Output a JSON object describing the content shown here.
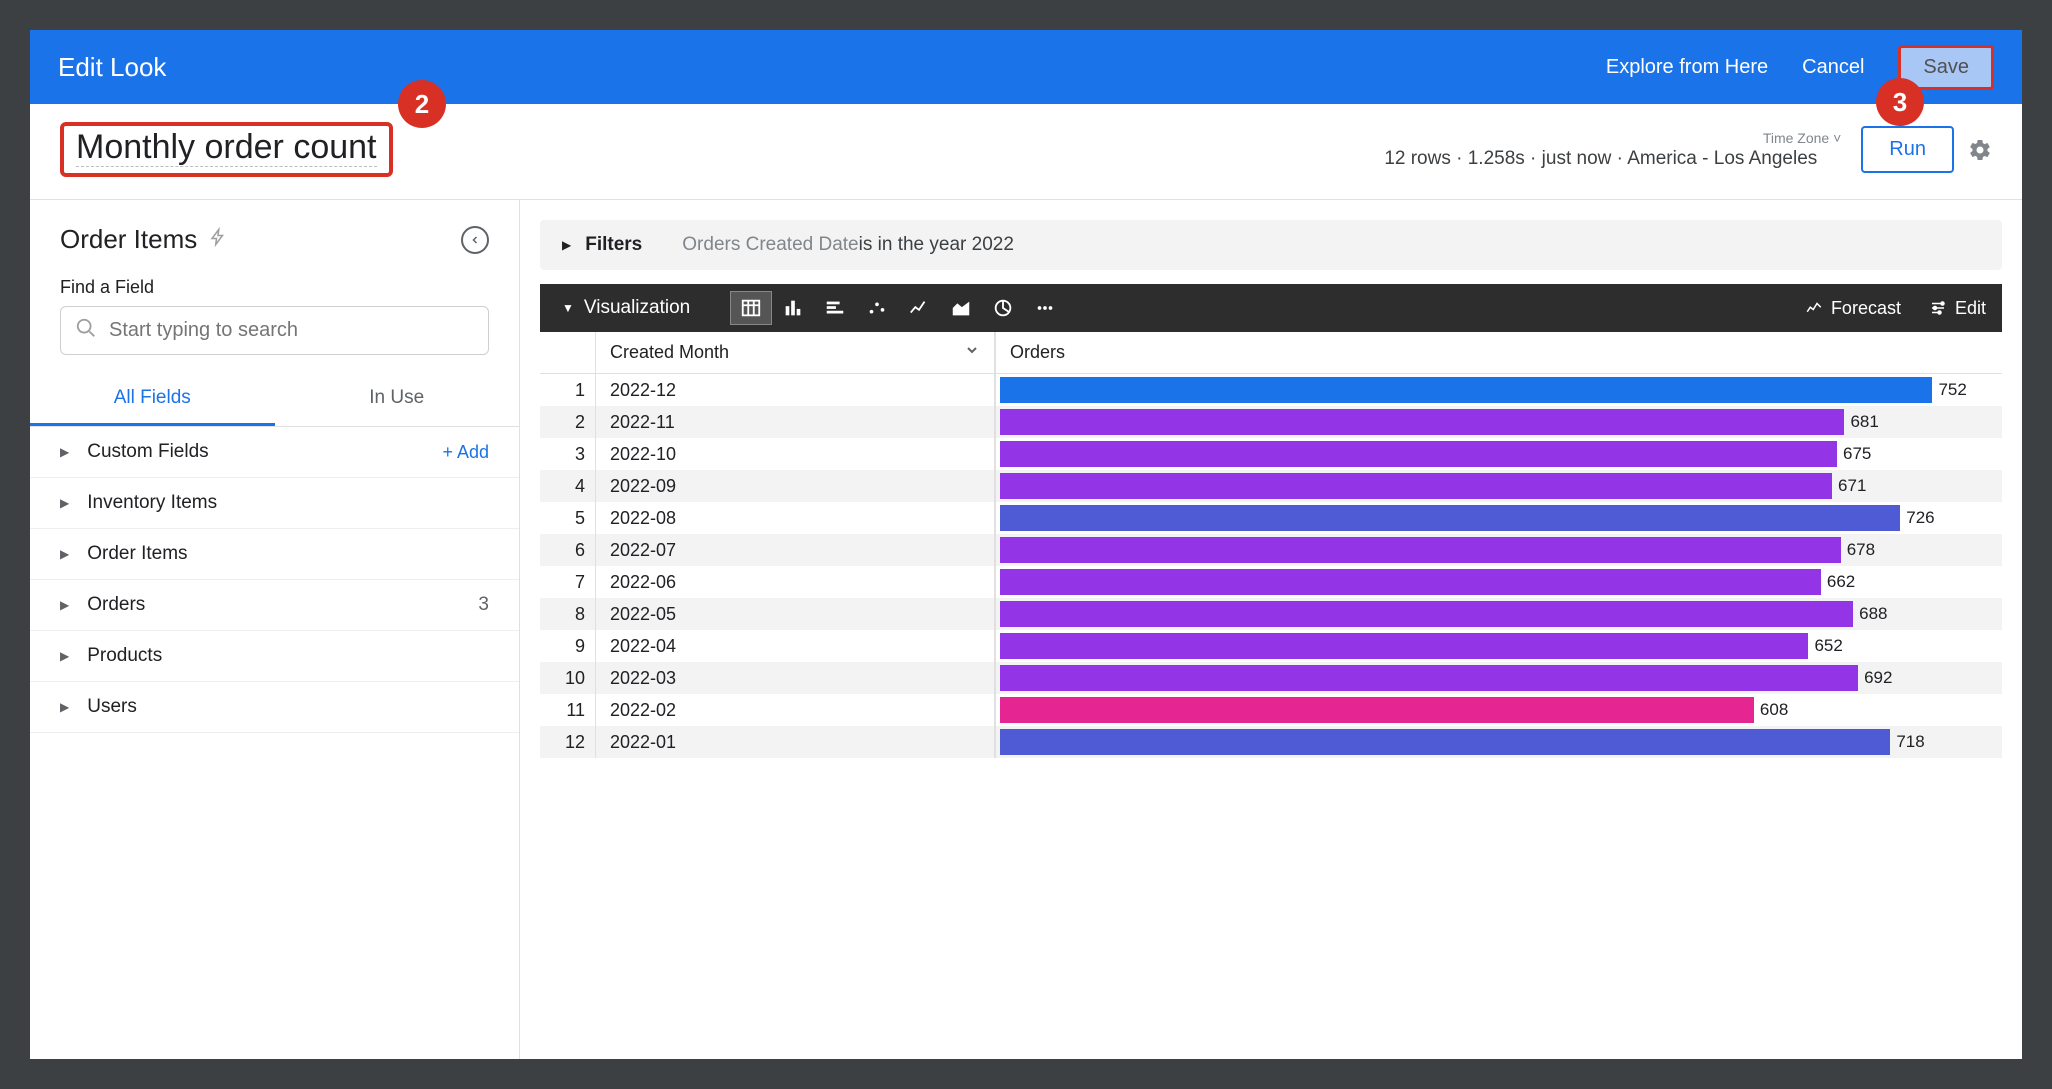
{
  "titlebar": {
    "title": "Edit Look",
    "explore_link": "Explore from Here",
    "cancel": "Cancel",
    "save": "Save"
  },
  "callouts": {
    "two": "2",
    "three": "3"
  },
  "header": {
    "look_title": "Monthly order count",
    "tz_label": "Time Zone ˅",
    "status": "12 rows · 1.258s · just now · America - Los Angeles",
    "run": "Run"
  },
  "sidebar": {
    "explore_name": "Order Items",
    "find_label": "Find a Field",
    "search_placeholder": "Start typing to search",
    "tabs": {
      "all": "All Fields",
      "in_use": "In Use"
    },
    "groups": [
      {
        "label": "Custom Fields",
        "add": "+  Add"
      },
      {
        "label": "Inventory Items"
      },
      {
        "label": "Order Items"
      },
      {
        "label": "Orders",
        "count": "3"
      },
      {
        "label": "Products"
      },
      {
        "label": "Users"
      }
    ]
  },
  "filters": {
    "label": "Filters",
    "prefix": "Orders Created Date ",
    "condition": "is in the year 2022"
  },
  "viz": {
    "label": "Visualization",
    "forecast": "Forecast",
    "edit": "Edit"
  },
  "table": {
    "col_month": "Created Month",
    "col_orders": "Orders"
  },
  "chart_data": {
    "type": "bar",
    "title": "Monthly order count",
    "xlabel": "Created Month",
    "ylabel": "Orders",
    "categories": [
      "2022-12",
      "2022-11",
      "2022-10",
      "2022-09",
      "2022-08",
      "2022-07",
      "2022-06",
      "2022-05",
      "2022-04",
      "2022-03",
      "2022-02",
      "2022-01"
    ],
    "values": [
      752,
      681,
      675,
      671,
      726,
      678,
      662,
      688,
      652,
      692,
      608,
      718
    ],
    "colors": [
      "#1a73e8",
      "#9334e6",
      "#9334e6",
      "#9334e6",
      "#4f5bd5",
      "#9334e6",
      "#9334e6",
      "#9334e6",
      "#9334e6",
      "#9334e6",
      "#e52592",
      "#4f5bd5"
    ],
    "ylim": [
      0,
      800
    ]
  }
}
